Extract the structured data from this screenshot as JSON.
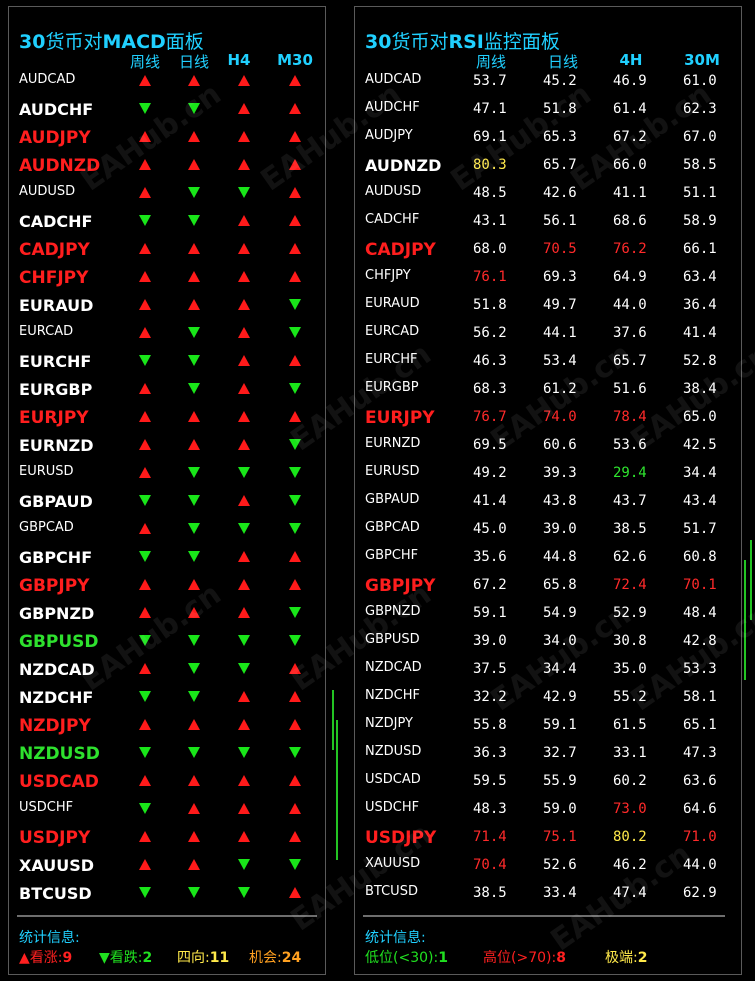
{
  "macd": {
    "title_num": "30",
    "title_cn": "货币对",
    "title_en": "MACD",
    "title_tail": "面板",
    "headers": [
      "周线",
      "日线",
      "H4",
      "M30"
    ],
    "rows": [
      {
        "sym": "AUDCAD",
        "style": "s",
        "a": [
          "up",
          "up",
          "up",
          "up"
        ]
      },
      {
        "sym": "AUDCHF",
        "style": "bw",
        "a": [
          "dn",
          "dn",
          "up",
          "up"
        ]
      },
      {
        "sym": "AUDJPY",
        "style": "br",
        "a": [
          "up",
          "up",
          "up",
          "up"
        ]
      },
      {
        "sym": "AUDNZD",
        "style": "br",
        "a": [
          "up",
          "up",
          "up",
          "up"
        ]
      },
      {
        "sym": "AUDUSD",
        "style": "s",
        "a": [
          "up",
          "dn",
          "dn",
          "up"
        ]
      },
      {
        "sym": "CADCHF",
        "style": "bw",
        "a": [
          "dn",
          "dn",
          "up",
          "up"
        ]
      },
      {
        "sym": "CADJPY",
        "style": "br",
        "a": [
          "up",
          "up",
          "up",
          "up"
        ]
      },
      {
        "sym": "CHFJPY",
        "style": "br",
        "a": [
          "up",
          "up",
          "up",
          "up"
        ]
      },
      {
        "sym": "EURAUD",
        "style": "bw",
        "a": [
          "up",
          "up",
          "up",
          "dn"
        ]
      },
      {
        "sym": "EURCAD",
        "style": "s",
        "a": [
          "up",
          "dn",
          "up",
          "dn"
        ]
      },
      {
        "sym": "EURCHF",
        "style": "bw",
        "a": [
          "dn",
          "dn",
          "up",
          "up"
        ]
      },
      {
        "sym": "EURGBP",
        "style": "bw",
        "a": [
          "up",
          "dn",
          "up",
          "dn"
        ]
      },
      {
        "sym": "EURJPY",
        "style": "br",
        "a": [
          "up",
          "up",
          "up",
          "up"
        ]
      },
      {
        "sym": "EURNZD",
        "style": "bw",
        "a": [
          "up",
          "up",
          "up",
          "dn"
        ]
      },
      {
        "sym": "EURUSD",
        "style": "s",
        "a": [
          "up",
          "dn",
          "dn",
          "dn"
        ]
      },
      {
        "sym": "GBPAUD",
        "style": "bw",
        "a": [
          "dn",
          "dn",
          "up",
          "dn"
        ]
      },
      {
        "sym": "GBPCAD",
        "style": "s",
        "a": [
          "up",
          "dn",
          "dn",
          "dn"
        ]
      },
      {
        "sym": "GBPCHF",
        "style": "bw",
        "a": [
          "dn",
          "dn",
          "up",
          "up"
        ]
      },
      {
        "sym": "GBPJPY",
        "style": "br",
        "a": [
          "up",
          "up",
          "up",
          "up"
        ]
      },
      {
        "sym": "GBPNZD",
        "style": "bw",
        "a": [
          "up",
          "up",
          "up",
          "dn"
        ]
      },
      {
        "sym": "GBPUSD",
        "style": "bg",
        "a": [
          "dn",
          "dn",
          "dn",
          "dn"
        ]
      },
      {
        "sym": "NZDCAD",
        "style": "bw",
        "a": [
          "up",
          "dn",
          "dn",
          "up"
        ]
      },
      {
        "sym": "NZDCHF",
        "style": "bw",
        "a": [
          "dn",
          "dn",
          "up",
          "up"
        ]
      },
      {
        "sym": "NZDJPY",
        "style": "br",
        "a": [
          "up",
          "up",
          "up",
          "up"
        ]
      },
      {
        "sym": "NZDUSD",
        "style": "bg",
        "a": [
          "dn",
          "dn",
          "dn",
          "dn"
        ]
      },
      {
        "sym": "USDCAD",
        "style": "br",
        "a": [
          "up",
          "up",
          "up",
          "up"
        ]
      },
      {
        "sym": "USDCHF",
        "style": "s",
        "a": [
          "dn",
          "up",
          "up",
          "up"
        ]
      },
      {
        "sym": "USDJPY",
        "style": "br",
        "a": [
          "up",
          "up",
          "up",
          "up"
        ]
      },
      {
        "sym": "XAUUSD",
        "style": "bw",
        "a": [
          "up",
          "up",
          "dn",
          "dn"
        ]
      },
      {
        "sym": "BTCUSD",
        "style": "bw",
        "a": [
          "dn",
          "dn",
          "dn",
          "up"
        ]
      }
    ],
    "stats_label": "统计信息:",
    "stats": [
      {
        "label": "▲看涨:",
        "value": "9",
        "color": "#ff2020"
      },
      {
        "label": "▼看跌:",
        "value": "2",
        "color": "#20e020"
      },
      {
        "label": "四向:",
        "value": "11",
        "color": "#ffe94a"
      },
      {
        "label": "机会:",
        "value": "24",
        "color": "#ffa020"
      }
    ]
  },
  "rsi": {
    "title_num": "30",
    "title_cn": "货币对",
    "title_en": "RSI",
    "title_tail": "监控面板",
    "headers": [
      "周线",
      "日线",
      "4H",
      "30M"
    ],
    "rows": [
      {
        "sym": "AUDCAD",
        "style": "s",
        "v": [
          "53.7",
          "45.2",
          "46.9",
          "61.0"
        ],
        "c": [
          "",
          "",
          "",
          ""
        ]
      },
      {
        "sym": "AUDCHF",
        "style": "s",
        "v": [
          "47.1",
          "51.8",
          "61.4",
          "62.3"
        ],
        "c": [
          "",
          "",
          "",
          ""
        ]
      },
      {
        "sym": "AUDJPY",
        "style": "s",
        "v": [
          "69.1",
          "65.3",
          "67.2",
          "67.0"
        ],
        "c": [
          "",
          "",
          "",
          ""
        ]
      },
      {
        "sym": "AUDNZD",
        "style": "bw",
        "v": [
          "80.3",
          "65.7",
          "66.0",
          "58.5"
        ],
        "c": [
          "y",
          "",
          "",
          ""
        ]
      },
      {
        "sym": "AUDUSD",
        "style": "s",
        "v": [
          "48.5",
          "42.6",
          "41.1",
          "51.1"
        ],
        "c": [
          "",
          "",
          "",
          ""
        ]
      },
      {
        "sym": "CADCHF",
        "style": "s",
        "v": [
          "43.1",
          "56.1",
          "68.6",
          "58.9"
        ],
        "c": [
          "",
          "",
          "",
          ""
        ]
      },
      {
        "sym": "CADJPY",
        "style": "br",
        "v": [
          "68.0",
          "70.5",
          "76.2",
          "66.1"
        ],
        "c": [
          "",
          "r",
          "r",
          ""
        ]
      },
      {
        "sym": "CHFJPY",
        "style": "s",
        "v": [
          "76.1",
          "69.3",
          "64.9",
          "63.4"
        ],
        "c": [
          "r",
          "",
          "",
          ""
        ]
      },
      {
        "sym": "EURAUD",
        "style": "s",
        "v": [
          "51.8",
          "49.7",
          "44.0",
          "36.4"
        ],
        "c": [
          "",
          "",
          "",
          ""
        ]
      },
      {
        "sym": "EURCAD",
        "style": "s",
        "v": [
          "56.2",
          "44.1",
          "37.6",
          "41.4"
        ],
        "c": [
          "",
          "",
          "",
          ""
        ]
      },
      {
        "sym": "EURCHF",
        "style": "s",
        "v": [
          "46.3",
          "53.4",
          "65.7",
          "52.8"
        ],
        "c": [
          "",
          "",
          "",
          ""
        ]
      },
      {
        "sym": "EURGBP",
        "style": "s",
        "v": [
          "68.3",
          "61.2",
          "51.6",
          "38.4"
        ],
        "c": [
          "",
          "",
          "",
          ""
        ]
      },
      {
        "sym": "EURJPY",
        "style": "br",
        "v": [
          "76.7",
          "74.0",
          "78.4",
          "65.0"
        ],
        "c": [
          "r",
          "r",
          "r",
          ""
        ]
      },
      {
        "sym": "EURNZD",
        "style": "s",
        "v": [
          "69.5",
          "60.6",
          "53.6",
          "42.5"
        ],
        "c": [
          "",
          "",
          "",
          ""
        ]
      },
      {
        "sym": "EURUSD",
        "style": "s",
        "v": [
          "49.2",
          "39.3",
          "29.4",
          "34.4"
        ],
        "c": [
          "",
          "",
          "g",
          ""
        ]
      },
      {
        "sym": "GBPAUD",
        "style": "s",
        "v": [
          "41.4",
          "43.8",
          "43.7",
          "43.4"
        ],
        "c": [
          "",
          "",
          "",
          ""
        ]
      },
      {
        "sym": "GBPCAD",
        "style": "s",
        "v": [
          "45.0",
          "39.0",
          "38.5",
          "51.7"
        ],
        "c": [
          "",
          "",
          "",
          ""
        ]
      },
      {
        "sym": "GBPCHF",
        "style": "s",
        "v": [
          "35.6",
          "44.8",
          "62.6",
          "60.8"
        ],
        "c": [
          "",
          "",
          "",
          ""
        ]
      },
      {
        "sym": "GBPJPY",
        "style": "br",
        "v": [
          "67.2",
          "65.8",
          "72.4",
          "70.1"
        ],
        "c": [
          "",
          "",
          "r",
          "r"
        ]
      },
      {
        "sym": "GBPNZD",
        "style": "s",
        "v": [
          "59.1",
          "54.9",
          "52.9",
          "48.4"
        ],
        "c": [
          "",
          "",
          "",
          ""
        ]
      },
      {
        "sym": "GBPUSD",
        "style": "s",
        "v": [
          "39.0",
          "34.0",
          "30.8",
          "42.8"
        ],
        "c": [
          "",
          "",
          "",
          ""
        ]
      },
      {
        "sym": "NZDCAD",
        "style": "s",
        "v": [
          "37.5",
          "34.4",
          "35.0",
          "53.3"
        ],
        "c": [
          "",
          "",
          "",
          ""
        ]
      },
      {
        "sym": "NZDCHF",
        "style": "s",
        "v": [
          "32.2",
          "42.9",
          "55.2",
          "58.1"
        ],
        "c": [
          "",
          "",
          "",
          ""
        ]
      },
      {
        "sym": "NZDJPY",
        "style": "s",
        "v": [
          "55.8",
          "59.1",
          "61.5",
          "65.1"
        ],
        "c": [
          "",
          "",
          "",
          ""
        ]
      },
      {
        "sym": "NZDUSD",
        "style": "s",
        "v": [
          "36.3",
          "32.7",
          "33.1",
          "47.3"
        ],
        "c": [
          "",
          "",
          "",
          ""
        ]
      },
      {
        "sym": "USDCAD",
        "style": "s",
        "v": [
          "59.5",
          "55.9",
          "60.2",
          "63.6"
        ],
        "c": [
          "",
          "",
          "",
          ""
        ]
      },
      {
        "sym": "USDCHF",
        "style": "s",
        "v": [
          "48.3",
          "59.0",
          "73.0",
          "64.6"
        ],
        "c": [
          "",
          "",
          "r",
          ""
        ]
      },
      {
        "sym": "USDJPY",
        "style": "br",
        "v": [
          "71.4",
          "75.1",
          "80.2",
          "71.0"
        ],
        "c": [
          "r",
          "r",
          "y",
          "r"
        ]
      },
      {
        "sym": "XAUUSD",
        "style": "s",
        "v": [
          "70.4",
          "52.6",
          "46.2",
          "44.0"
        ],
        "c": [
          "r",
          "",
          "",
          ""
        ]
      },
      {
        "sym": "BTCUSD",
        "style": "s",
        "v": [
          "38.5",
          "33.4",
          "47.4",
          "62.9"
        ],
        "c": [
          "",
          "",
          "",
          ""
        ]
      }
    ],
    "stats_label": "统计信息:",
    "stats": [
      {
        "label": "低位(<30):",
        "value": "1",
        "color": "#20e020"
      },
      {
        "label": "高位(>70):",
        "value": "8",
        "color": "#ff2020"
      },
      {
        "label": "极端:",
        "value": "2",
        "color": "#ffe94a"
      }
    ]
  },
  "watermark": "EAHub.cn"
}
